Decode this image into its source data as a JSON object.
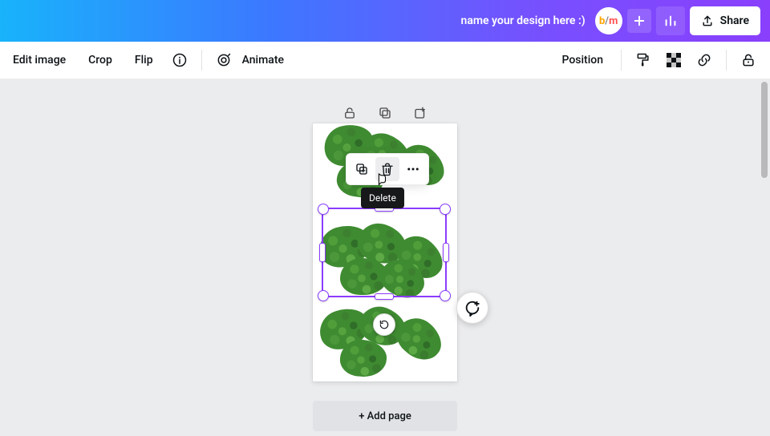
{
  "header": {
    "design_name_placeholder": "name your design here :)",
    "avatar_text": "b/m",
    "share_label": "Share"
  },
  "toolbar": {
    "edit_image": "Edit image",
    "crop": "Crop",
    "flip": "Flip",
    "animate": "Animate",
    "position": "Position"
  },
  "tooltip": {
    "delete": "Delete"
  },
  "footer": {
    "add_page": "+ Add page"
  }
}
